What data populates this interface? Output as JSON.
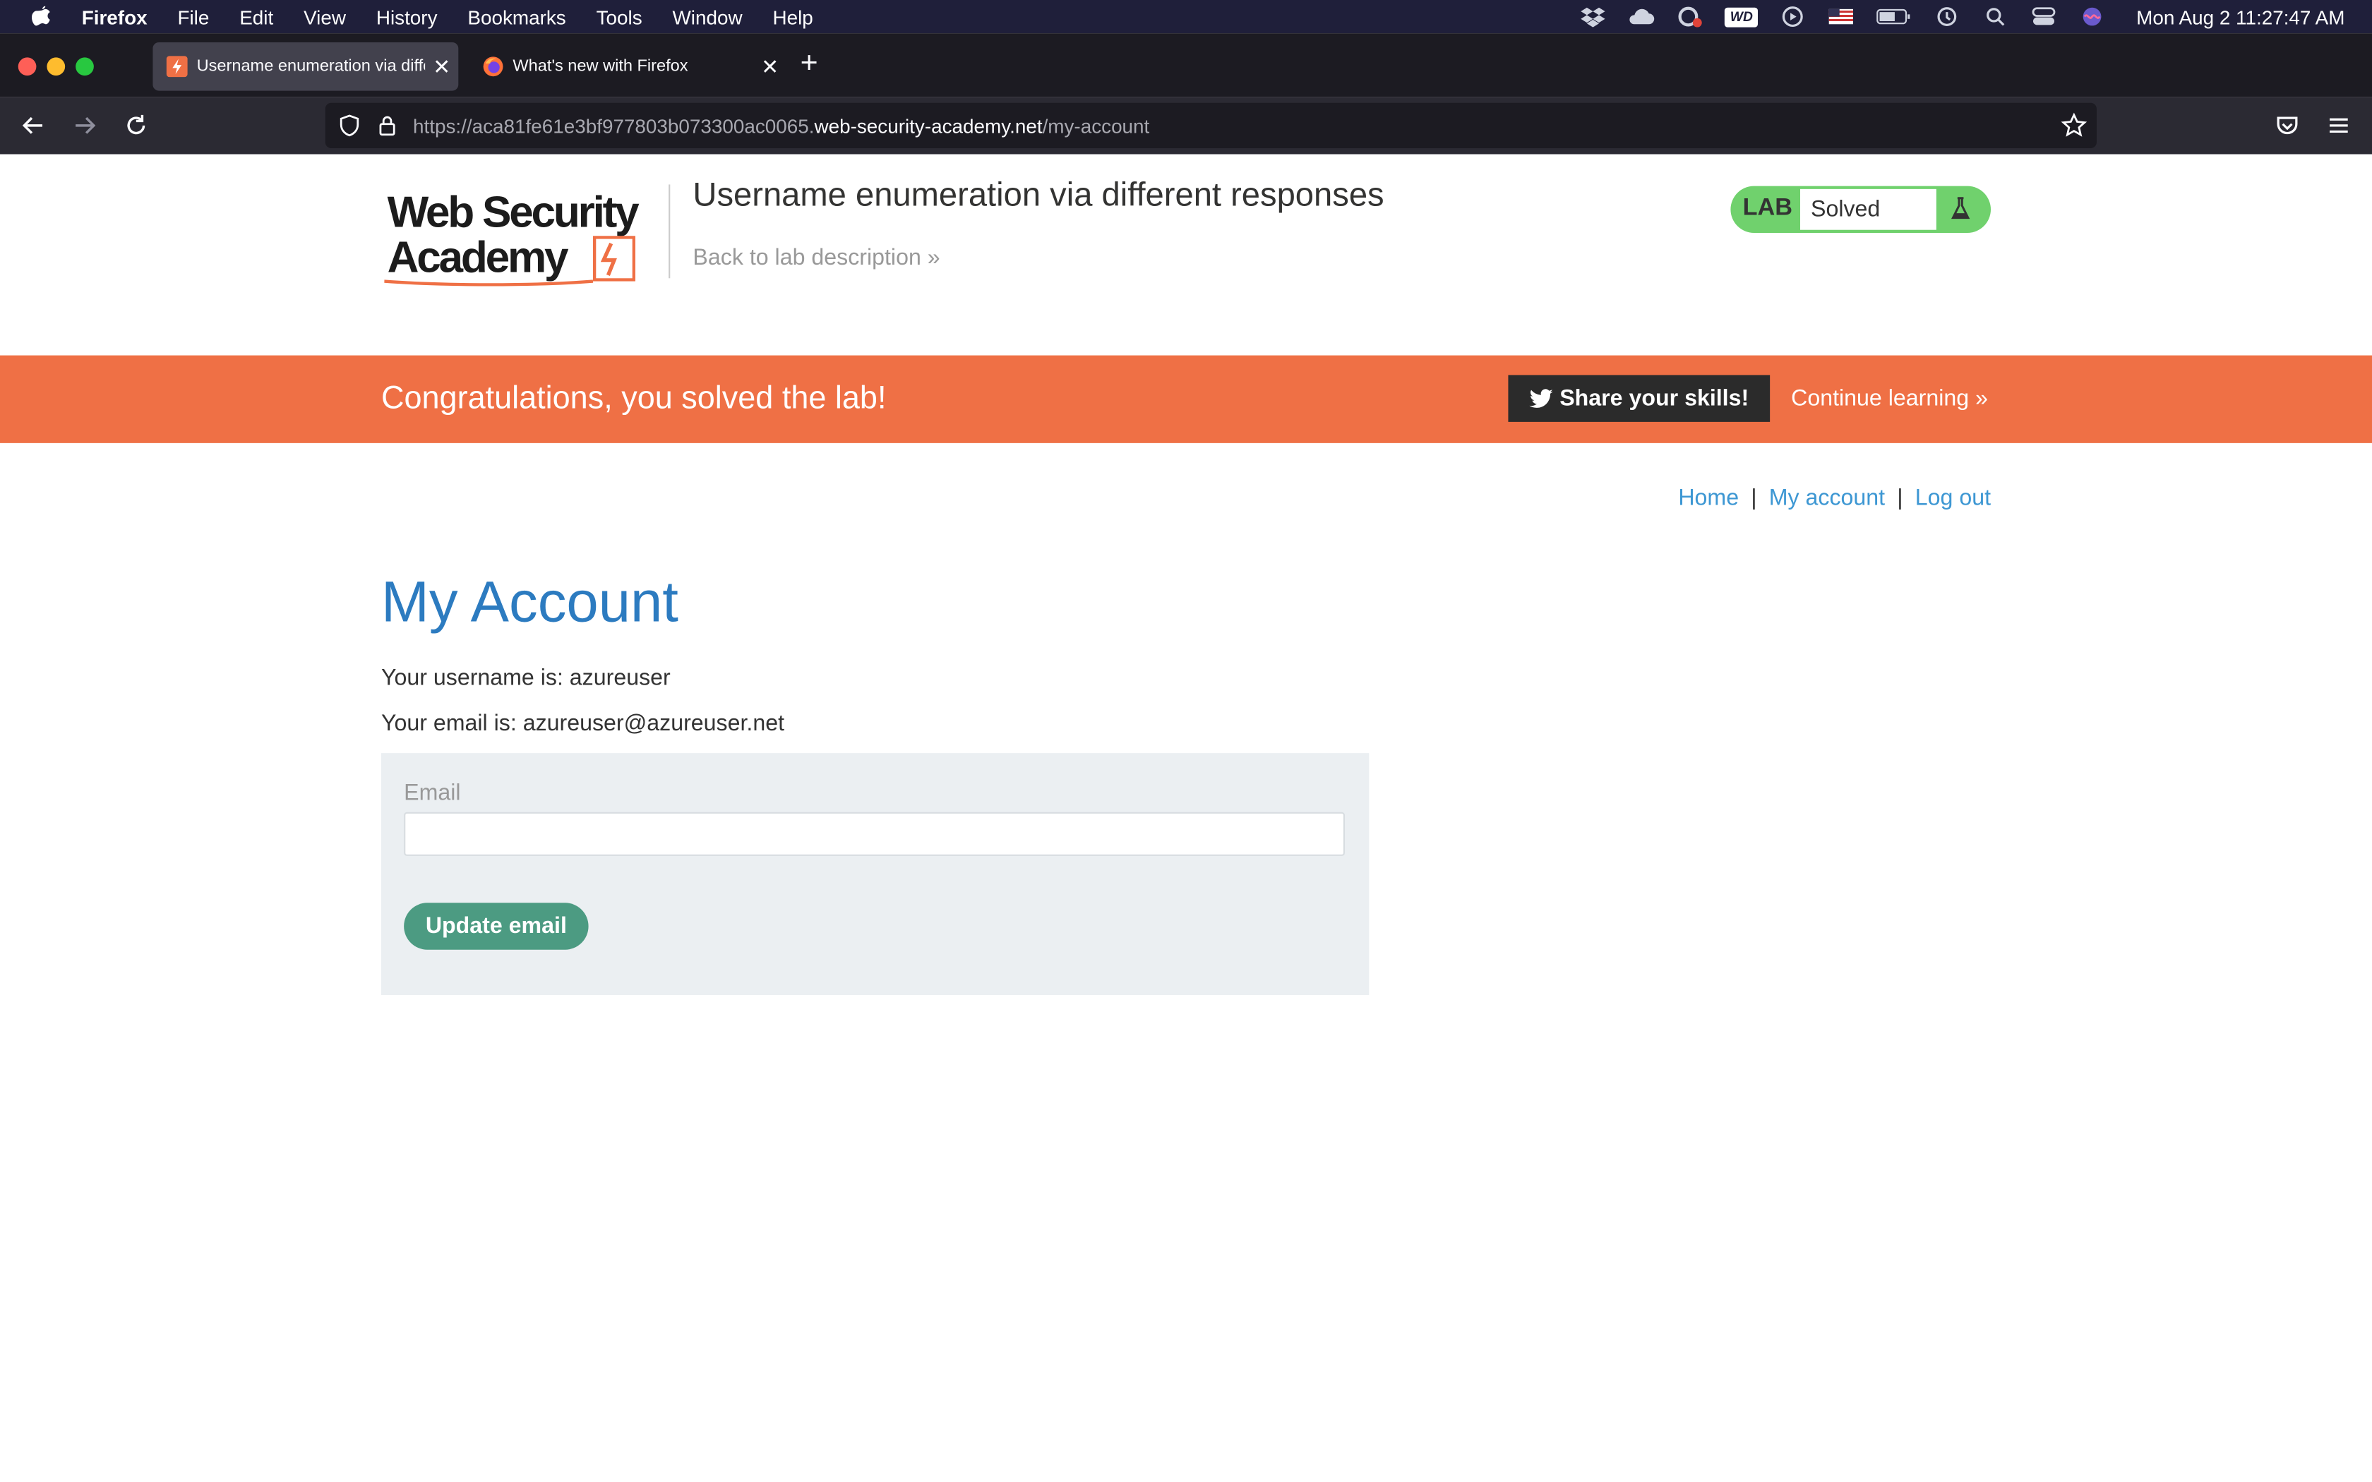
{
  "menubar": {
    "app": "Firefox",
    "items": [
      "File",
      "Edit",
      "View",
      "History",
      "Bookmarks",
      "Tools",
      "Window",
      "Help"
    ],
    "status_icons": [
      "dropbox-icon",
      "cloud-icon",
      "creative-cloud-icon",
      "wd-icon",
      "play-icon",
      "us-flag-icon",
      "battery-icon",
      "time-machine-icon",
      "search-icon",
      "control-center-icon",
      "siri-icon"
    ],
    "wd_label": "WD",
    "clock": "Mon Aug 2  11:27:47 AM"
  },
  "tabs": [
    {
      "title": "Username enumeration via different responses",
      "active": true,
      "favicon": "web-security-academy-favicon"
    },
    {
      "title": "What's new with Firefox",
      "active": false,
      "favicon": "firefox-favicon"
    }
  ],
  "navbar": {
    "url_prefix": "https://aca81fe61e3bf977803b073300ac0065.",
    "url_host": "web-security-academy.net",
    "url_path": "/my-account"
  },
  "lab_header": {
    "logo_text_line1": "Web Security",
    "logo_text_line2": "Academy",
    "title": "Username enumeration via different responses",
    "back_link": "Back to lab description",
    "back_chevrons": "»",
    "badge_label": "LAB",
    "badge_status": "Solved"
  },
  "banner": {
    "message": "Congratulations, you solved the lab!",
    "share_label": "Share your skills!",
    "continue_label": "Continue learning",
    "continue_chevrons": "»"
  },
  "topnav": {
    "home": "Home",
    "my_account": "My account",
    "logout": "Log out",
    "separator": "|"
  },
  "account": {
    "heading": "My Account",
    "username_line": "Your username is: azureuser",
    "email_line": "Your email is: azureuser@azureuser.net",
    "form_label": "Email",
    "email_value": "",
    "button_label": "Update email"
  },
  "colors": {
    "banner": "#ef7045",
    "heading": "#2c7bc0",
    "link": "#3d97d3",
    "badge": "#70d16d",
    "button": "#4c9b82"
  }
}
